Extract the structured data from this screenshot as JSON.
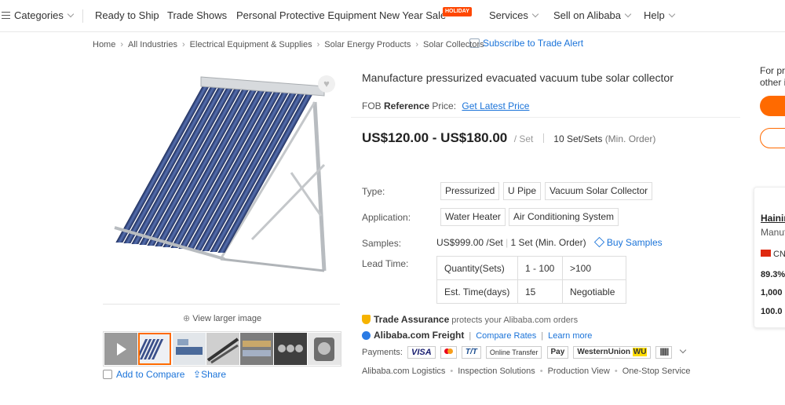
{
  "nav": {
    "categories": "Categories",
    "items": [
      "Ready to Ship",
      "Trade Shows",
      "Personal Protective Equipment",
      "New Year Sale",
      "Services",
      "Sell on Alibaba",
      "Help"
    ],
    "holiday_badge": "HOLIDAY"
  },
  "breadcrumb": [
    "Home",
    "All Industries",
    "Electrical Equipment & Supplies",
    "Solar Energy Products",
    "Solar Collectors"
  ],
  "subscribe": "Subscribe to Trade Alert",
  "gallery": {
    "view_larger": "View larger image",
    "add_to_compare": "Add to Compare",
    "share": "Share"
  },
  "product": {
    "title": "Manufacture pressurized evacuated vacuum tube solar collector",
    "fob_prefix": "FOB",
    "fob_reference": "Reference",
    "fob_price_label": "Price:",
    "latest_price_link": "Get Latest Price",
    "price_range": "US$120.00 - US$180.00",
    "price_unit": "/ Set",
    "moq": "10 Set/Sets",
    "moq_note": "(Min. Order)"
  },
  "attributes": {
    "type_label": "Type:",
    "type_values": [
      "Pressurized",
      "U Pipe",
      "Vacuum Solar Collector"
    ],
    "application_label": "Application:",
    "application_values": [
      "Water Heater",
      "Air Conditioning System"
    ],
    "samples_label": "Samples:",
    "samples_value": "US$999.00 /Set",
    "samples_moq": "1 Set (Min. Order)",
    "buy_samples": "Buy Samples",
    "lead_time_label": "Lead Time:",
    "lead_time": {
      "row1": [
        "Quantity(Sets)",
        "1 - 100",
        ">100"
      ],
      "row2": [
        "Est. Time(days)",
        "15",
        "Negotiable"
      ]
    }
  },
  "assurance": {
    "trade_assurance": "Trade Assurance",
    "trade_assurance_note": "protects your Alibaba.com orders",
    "freight": "Alibaba.com Freight",
    "compare_rates": "Compare Rates",
    "learn_more": "Learn more",
    "payments_label": "Payments:",
    "payment_methods": [
      "VISA",
      "T/T",
      "Online Transfer",
      "Pay",
      "WesternUnion",
      "WU"
    ],
    "services": [
      "Alibaba.com Logistics",
      "Inspection Solutions",
      "Production View",
      "One-Stop Service"
    ]
  },
  "right_panel": {
    "line1": "For pr",
    "line2": "other i",
    "supplier_name": "Hainin",
    "supplier_type": "Manuf",
    "country": "CN",
    "stat1": "89.3%",
    "stat2": "1,000",
    "stat3": "100.0"
  },
  "colors": {
    "accent": "#ff6a00",
    "link": "#1a73d9",
    "holiday": "#ff4700"
  }
}
